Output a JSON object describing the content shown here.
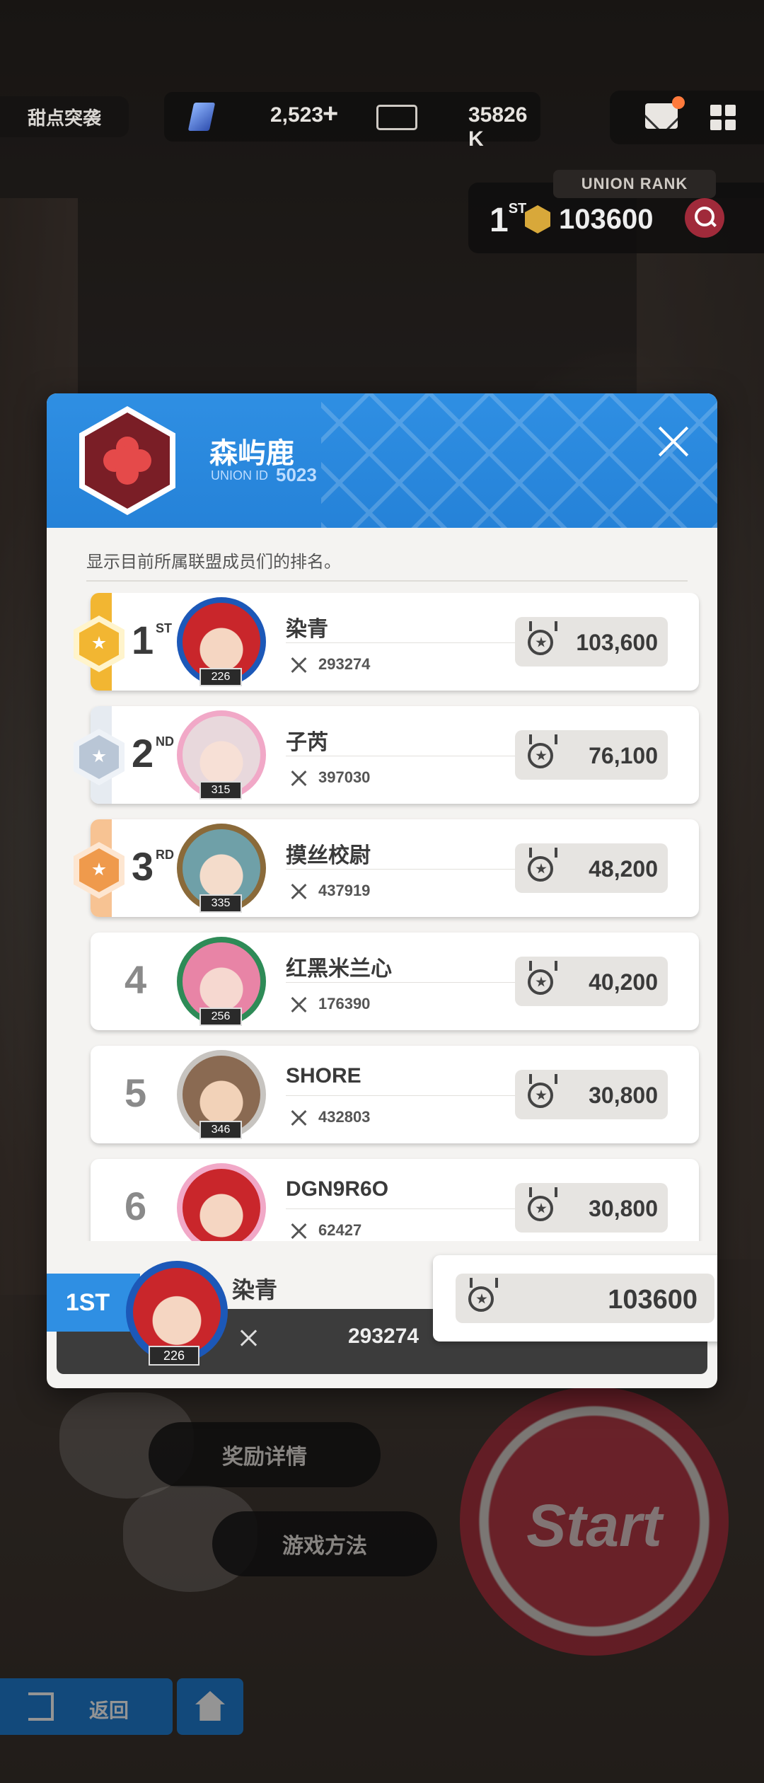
{
  "hud": {
    "event_tag": "甜点突袭",
    "gems": "2,523",
    "gems_plus": "+",
    "credits": "35826 K",
    "icons": [
      "gem-icon",
      "ticket-icon",
      "mail-icon",
      "menu-grid-icon"
    ]
  },
  "union_rank_widget": {
    "label": "UNION RANK",
    "position": "1",
    "position_suffix": "ST",
    "score": "103600"
  },
  "modal": {
    "union_name": "森屿鹿",
    "union_id_label": "UNION ID",
    "union_id": "5023",
    "description": "显示目前所属联盟成员们的排名。",
    "members": [
      {
        "rank": "1",
        "suffix": "ST",
        "name": "染青",
        "level": "226",
        "power": "293274",
        "score": "103,600",
        "medal": "gold"
      },
      {
        "rank": "2",
        "suffix": "ND",
        "name": "子芮",
        "level": "315",
        "power": "397030",
        "score": "76,100",
        "medal": "silver"
      },
      {
        "rank": "3",
        "suffix": "RD",
        "name": "摸丝校尉",
        "level": "335",
        "power": "437919",
        "score": "48,200",
        "medal": "bronze"
      },
      {
        "rank": "4",
        "suffix": "",
        "name": "红黑米兰心",
        "level": "256",
        "power": "176390",
        "score": "40,200",
        "medal": ""
      },
      {
        "rank": "5",
        "suffix": "",
        "name": "SHORE",
        "level": "346",
        "power": "432803",
        "score": "30,800",
        "medal": ""
      },
      {
        "rank": "6",
        "suffix": "",
        "name": "DGN9R6O",
        "level": "",
        "power": "62427",
        "score": "30,800",
        "medal": ""
      }
    ],
    "self": {
      "rank": "1ST",
      "name": "染青",
      "level": "226",
      "power": "293274",
      "score": "103600"
    }
  },
  "game": {
    "reward_details": "奖励详情",
    "how_to_play": "游戏方法",
    "start": "Start",
    "back": "返回"
  },
  "colors": {
    "accent_blue": "#2f8fe3",
    "gold": "#f2b632",
    "silver": "#b9c6d6",
    "bronze": "#ef9a4c"
  }
}
